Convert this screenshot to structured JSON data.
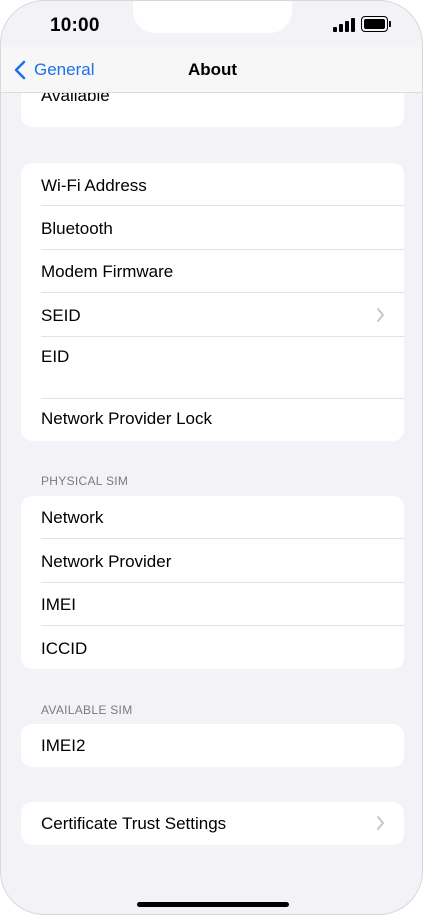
{
  "status_bar": {
    "time": "10:00"
  },
  "nav": {
    "back_label": "General",
    "title": "About"
  },
  "group0": {
    "rows": [
      {
        "label": "Available"
      }
    ]
  },
  "group1": {
    "rows": [
      {
        "label": "Wi-Fi Address"
      },
      {
        "label": "Bluetooth"
      },
      {
        "label": "Modem Firmware"
      },
      {
        "label": "SEID",
        "has_chevron": true
      },
      {
        "label": "EID"
      },
      {
        "label": "Network Provider Lock"
      }
    ]
  },
  "physical_sim": {
    "header": "PHYSICAL SIM",
    "rows": [
      {
        "label": "Network"
      },
      {
        "label": "Network Provider"
      },
      {
        "label": "IMEI"
      },
      {
        "label": "ICCID"
      }
    ]
  },
  "available_sim": {
    "header": "AVAILABLE SIM",
    "rows": [
      {
        "label": "IMEI2"
      }
    ]
  },
  "certificate": {
    "rows": [
      {
        "label": "Certificate Trust Settings",
        "has_chevron": true
      }
    ]
  },
  "colors": {
    "accent": "#1a73e8",
    "background": "#f2f2f7",
    "separator": "#e3e3e6",
    "section_header": "#7a7a80"
  },
  "icons": [
    "chevron-left-icon",
    "chevron-right-icon",
    "signal-icon",
    "battery-icon"
  ]
}
